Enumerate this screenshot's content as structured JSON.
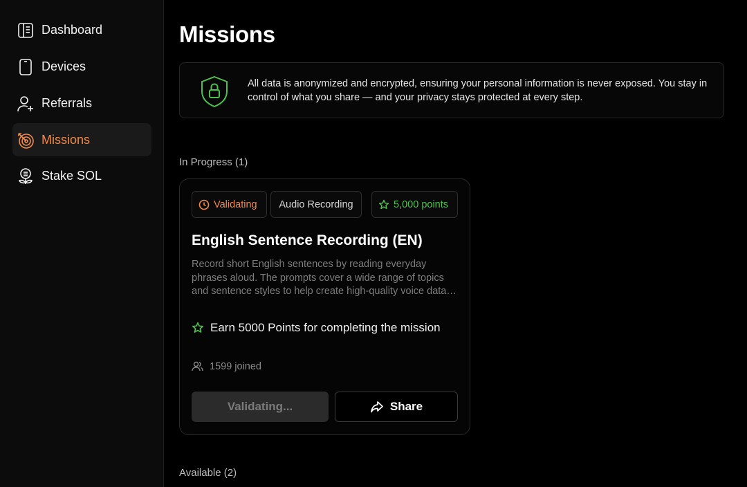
{
  "sidebar": {
    "items": [
      {
        "label": "Dashboard",
        "icon": "dashboard-icon"
      },
      {
        "label": "Devices",
        "icon": "device-icon"
      },
      {
        "label": "Referrals",
        "icon": "add-user-icon"
      },
      {
        "label": "Missions",
        "icon": "target-icon",
        "active": true
      },
      {
        "label": "Stake SOL",
        "icon": "stake-icon"
      }
    ]
  },
  "page": {
    "title": "Missions",
    "privacy_notice": "All data is anonymized and encrypted, ensuring your personal information is never exposed. You stay in control of what you share — and your privacy stays protected at every step."
  },
  "sections": {
    "in_progress_label": "In Progress (1)",
    "available_label": "Available (2)"
  },
  "mission": {
    "status": "Validating",
    "type": "Audio Recording",
    "points": "5,000 points",
    "title": "English Sentence Recording (EN)",
    "description": "Record short English sentences by reading everyday phrases aloud. The prompts cover a wide range of topics and sentence styles to help create high-quality voice data for speech recognition and language technology.",
    "reward": "Earn 5000 Points for completing the mission",
    "joined": "1599 joined",
    "primary_button": "Validating...",
    "share_button": "Share"
  },
  "colors": {
    "accent_orange": "#f08a4b",
    "accent_green": "#4fc04f",
    "background": "#000000",
    "sidebar": "#0c0c0c"
  }
}
